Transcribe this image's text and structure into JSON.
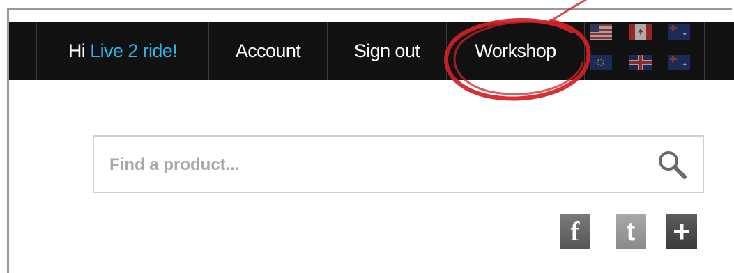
{
  "nav": {
    "greeting_prefix": "Hi",
    "greeting_name": "Live 2 ride!",
    "account_label": "Account",
    "signout_label": "Sign out",
    "workshop_label": "Workshop"
  },
  "flags": [
    "us-flag",
    "canada-flag",
    "australia-flag",
    "eu-flag",
    "uk-flag",
    "new-zealand-flag"
  ],
  "search": {
    "placeholder": "Find a product...",
    "icon": "search-icon"
  },
  "social": {
    "facebook_glyph": "f",
    "twitter_glyph": "t",
    "share_glyph": "+"
  },
  "colors": {
    "nav_bg": "#111111",
    "greeting_accent": "#2bb5e8",
    "annotation_circle": "#d42027"
  }
}
